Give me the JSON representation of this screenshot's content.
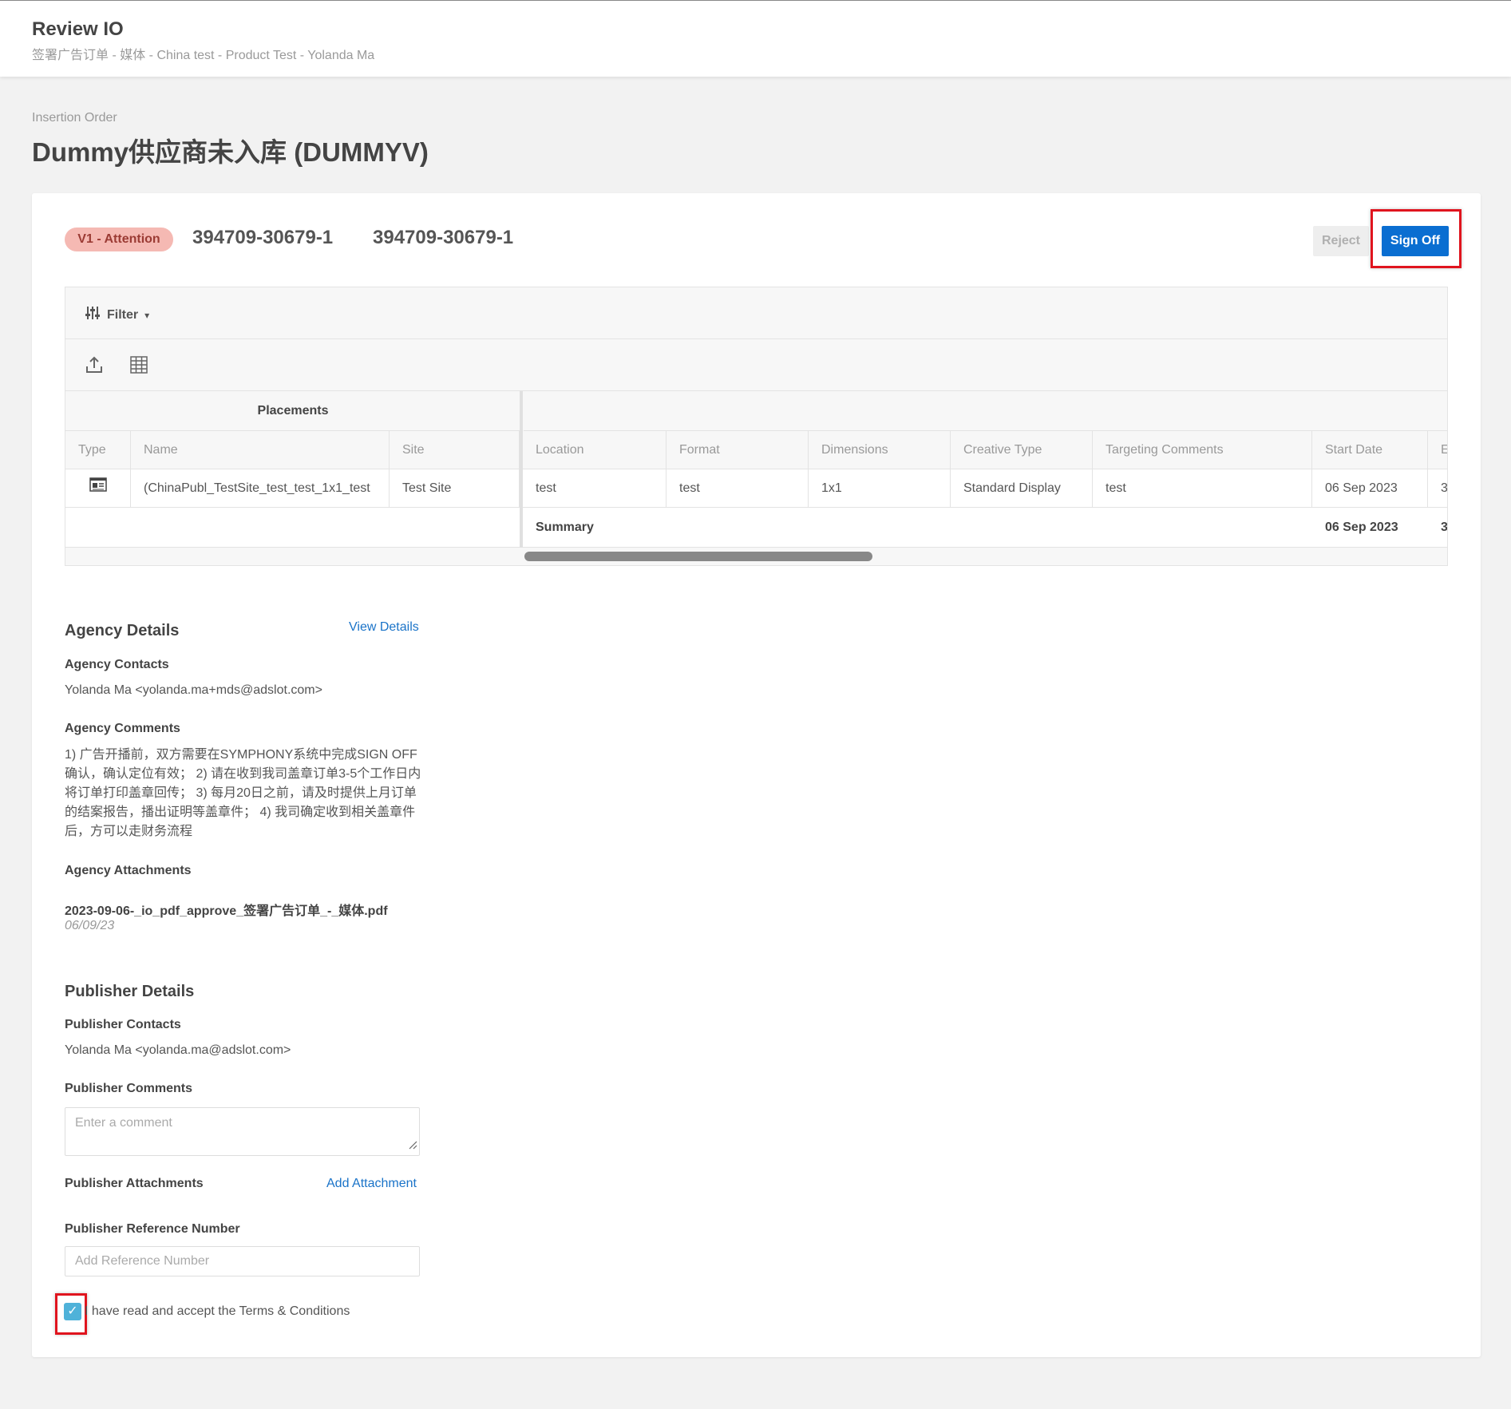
{
  "header": {
    "title": "Review IO",
    "breadcrumb": "签署广告订单 - 媒体 - China test - Product Test - Yolanda Ma"
  },
  "page": {
    "doc_type": "Insertion Order",
    "title": "Dummy供应商未入库 (DUMMYV)"
  },
  "order": {
    "status": "V1 - Attention",
    "id_primary": "394709-30679-1",
    "id_secondary": "394709-30679-1",
    "reject_label": "Reject",
    "signoff_label": "Sign Off"
  },
  "grid": {
    "filter_label": "Filter",
    "filter_caret": "▾",
    "pinned_group": "Placements",
    "columns": {
      "type": "Type",
      "name": "Name",
      "site": "Site",
      "location": "Location",
      "format": "Format",
      "dimensions": "Dimensions",
      "creative_type": "Creative Type",
      "targeting": "Targeting Comments",
      "start_date": "Start Date",
      "end_partial": "E"
    },
    "row": {
      "name": "(ChinaPubl_TestSite_test_test_1x1_test",
      "site": "Test Site",
      "location": "test",
      "format": "test",
      "dimensions": "1x1",
      "creative_type": "Standard Display",
      "targeting": "test",
      "start_date": "06 Sep 2023",
      "end_partial": "3"
    },
    "summary": {
      "label": "Summary",
      "start_date": "06 Sep 2023",
      "end_partial": "3"
    },
    "icons": {
      "filter": "sliders-icon",
      "export": "upload-icon",
      "columns": "table-grid-icon",
      "type": "display-ad-icon"
    }
  },
  "agency": {
    "title": "Agency Details",
    "view_details": "View Details",
    "contacts_label": "Agency Contacts",
    "contacts": "Yolanda Ma <yolanda.ma+mds@adslot.com>",
    "comments_label": "Agency Comments",
    "comments": "1) 广告开播前，双方需要在SYMPHONY系统中完成SIGN OFF确认，确认定位有效； 2) 请在收到我司盖章订单3-5个工作日内将订单打印盖章回传； 3) 每月20日之前，请及时提供上月订单的结案报告，播出证明等盖章件； 4) 我司确定收到相关盖章件后，方可以走财务流程",
    "attachments_label": "Agency Attachments",
    "attachment_name": "2023-09-06-_io_pdf_approve_签署广告订单_-_媒体.pdf",
    "attachment_date": "06/09/23"
  },
  "publisher": {
    "title": "Publisher Details",
    "contacts_label": "Publisher Contacts",
    "contacts": "Yolanda Ma <yolanda.ma@adslot.com>",
    "comments_label": "Publisher Comments",
    "comment_placeholder": "Enter a comment",
    "attachments_label": "Publisher Attachments",
    "add_attachment": "Add Attachment",
    "ref_label": "Publisher Reference Number",
    "ref_placeholder": "Add Reference Number",
    "terms": "I have read and accept the Terms & Conditions",
    "terms_checked": true
  },
  "colors": {
    "primary": "#0a6ed1",
    "badge_bg": "#f5b9b3",
    "badge_text": "#9b3b34",
    "highlight": "#e0141e",
    "checkbox": "#4fb2d9",
    "link": "#1a73c8"
  }
}
